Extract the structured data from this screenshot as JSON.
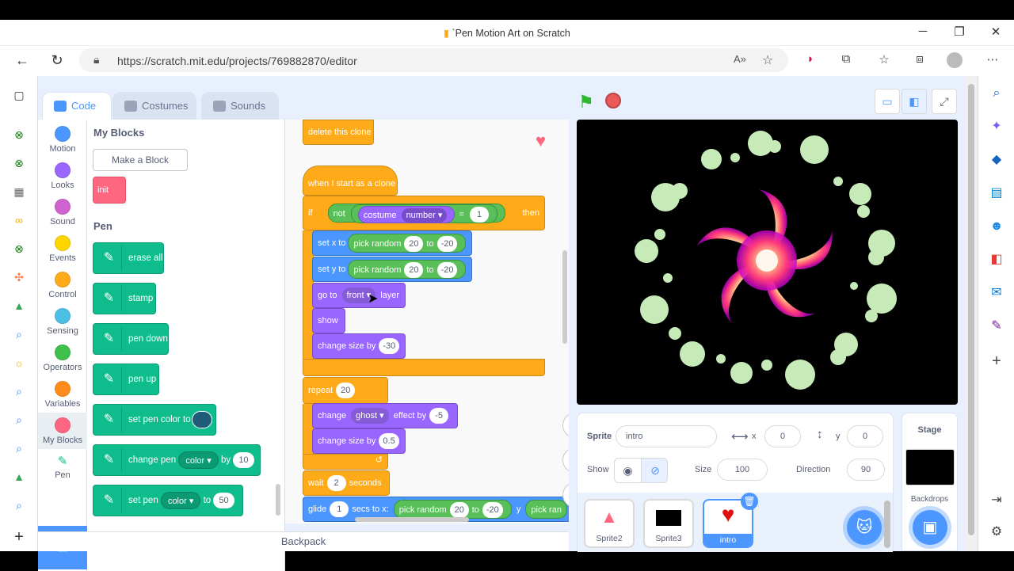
{
  "browser": {
    "window_title": "`Pen Motion Art on Scratch",
    "url": "https://scratch.mit.edu/projects/769882870/editor"
  },
  "tabs": [
    {
      "label": "Code"
    },
    {
      "label": "Costumes"
    },
    {
      "label": "Sounds"
    }
  ],
  "categories": [
    {
      "label": "Motion",
      "color": "#4c97ff"
    },
    {
      "label": "Looks",
      "color": "#9966ff"
    },
    {
      "label": "Sound",
      "color": "#cf63cf"
    },
    {
      "label": "Events",
      "color": "#ffd500"
    },
    {
      "label": "Control",
      "color": "#ffab19"
    },
    {
      "label": "Sensing",
      "color": "#4cbfe6"
    },
    {
      "label": "Operators",
      "color": "#40bf4a"
    },
    {
      "label": "Variables",
      "color": "#ff8c1a"
    },
    {
      "label": "My Blocks",
      "color": "#ff6680"
    },
    {
      "label": "Pen",
      "color": "#0fbd8c"
    }
  ],
  "palette": {
    "my_blocks_heading": "My Blocks",
    "make_block_label": "Make a Block",
    "init_block": "init",
    "pen_heading": "Pen",
    "pen_blocks": {
      "erase_all": "erase all",
      "stamp": "stamp",
      "pen_down": "pen down",
      "pen_up": "pen up",
      "set_pen_color": "set pen color to",
      "change_pen": "change pen",
      "change_pen_dd": "color",
      "change_pen_by": "by",
      "change_pen_val": "10",
      "set_pen": "set pen",
      "set_pen_dd": "color",
      "set_pen_to": "to",
      "set_pen_val": "50"
    }
  },
  "script": {
    "delete_clone": "delete this clone",
    "hat": "when I start as a clone",
    "if": "if",
    "then": "then",
    "not": "not",
    "costume": "costume",
    "number": "number",
    "eq": "=",
    "eq_val": "1",
    "setx": "set x to",
    "sety": "set y to",
    "pick_random": "pick random",
    "to": "to",
    "r_from": "20",
    "r_to": "-20",
    "goto": "go to",
    "front": "front",
    "layer": "layer",
    "show": "show",
    "change_size": "change size by",
    "change_size_val": "-30",
    "repeat": "repeat",
    "repeat_val": "20",
    "change": "change",
    "ghost": "ghost",
    "effect_by": "effect by",
    "effect_val": "-5",
    "change_size_val2": "0.5",
    "wait": "wait",
    "wait_val": "2",
    "seconds": "seconds",
    "glide": "glide",
    "glide_val": "1",
    "secs_to_x": "secs to x:",
    "y": "y",
    "pick_ran": "pick ran"
  },
  "backpack_label": "Backpack",
  "sprite_info": {
    "sprite_label": "Sprite",
    "sprite_name": "intro",
    "x_label": "x",
    "x_val": "0",
    "y_label": "y",
    "y_val": "0",
    "show_label": "Show",
    "size_label": "Size",
    "size_val": "100",
    "direction_label": "Direction",
    "direction_val": "90"
  },
  "sprites": [
    {
      "name": "Sprite2"
    },
    {
      "name": "Sprite3"
    },
    {
      "name": "intro"
    }
  ],
  "stage_panel": {
    "title": "Stage",
    "backdrops_label": "Backdrops"
  }
}
